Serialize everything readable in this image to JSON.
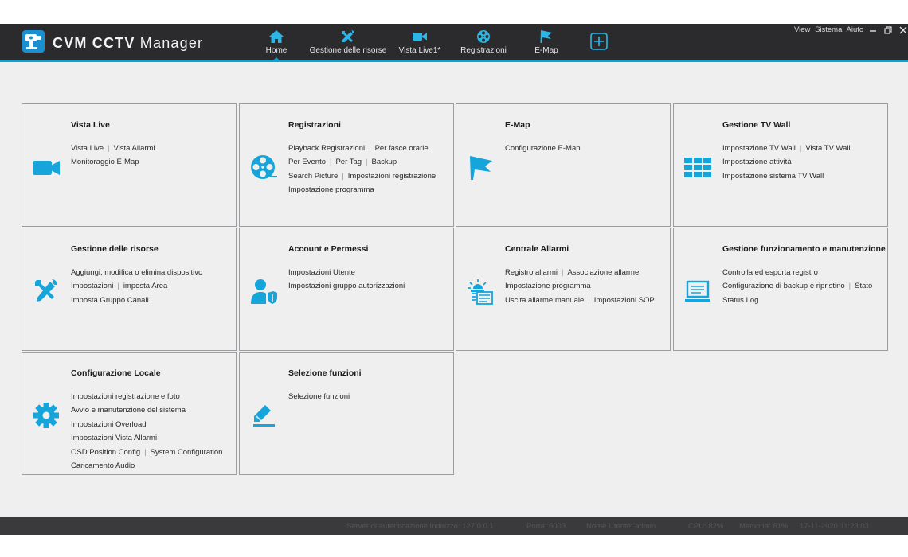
{
  "app": {
    "title_bold": "CVM CCTV",
    "title_rest": " Manager"
  },
  "nav": {
    "tabs": [
      {
        "label": "Home",
        "icon": "home-icon"
      },
      {
        "label": "Gestione delle risorse",
        "icon": "tools-icon"
      },
      {
        "label": "Vista Live1*",
        "icon": "camera-icon"
      },
      {
        "label": "Registrazioni",
        "icon": "film-reel-icon"
      },
      {
        "label": "E-Map",
        "icon": "flag-icon"
      }
    ],
    "active": "Home",
    "add_icon": "add-tab-icon"
  },
  "window_menu": {
    "view": "View",
    "system": "Sistema",
    "help": "Aiuto"
  },
  "colors": {
    "accent": "#0aa3d8",
    "titlebar": "#2b2b2d",
    "panel": "#efeff0",
    "border": "#9d9d9f",
    "statusbar": "#3a3a3c"
  },
  "cards": [
    {
      "title": "Vista Live",
      "icon": "camera-icon",
      "rows": [
        [
          "Vista Live",
          "Vista Allarmi"
        ],
        [
          "Monitoraggio E-Map"
        ]
      ]
    },
    {
      "title": "Registrazioni",
      "icon": "film-reel-icon",
      "rows": [
        [
          "Playback Registrazioni",
          "Per fasce orarie"
        ],
        [
          "Per Evento",
          "Per Tag",
          "Backup"
        ],
        [
          "Search Picture",
          "Impostazioni registrazione"
        ],
        [
          "Impostazione programma"
        ]
      ]
    },
    {
      "title": "E-Map",
      "icon": "flag-icon",
      "rows": [
        [
          "Configurazione E-Map"
        ]
      ]
    },
    {
      "title": "Gestione TV Wall",
      "icon": "tv-wall-icon",
      "rows": [
        [
          "Impostazione TV Wall",
          "Vista TV Wall"
        ],
        [
          "Impostazione attività"
        ],
        [
          "Impostazione sistema TV Wall"
        ]
      ]
    },
    {
      "title": "Gestione delle risorse",
      "icon": "tools-icon",
      "rows": [
        [
          "Aggiungi, modifica o elimina dispositivo"
        ],
        [
          "Impostazioni",
          "imposta Area"
        ],
        [
          "Imposta Gruppo Canali"
        ]
      ]
    },
    {
      "title": "Account e Permessi",
      "icon": "user-shield-icon",
      "rows": [
        [
          "Impostazioni Utente"
        ],
        [
          "Impostazioni gruppo autorizzazioni"
        ]
      ]
    },
    {
      "title": "Centrale Allarmi",
      "icon": "alarm-center-icon",
      "rows": [
        [
          "Registro allarmi",
          "Associazione allarme"
        ],
        [
          "Impostazione programma"
        ],
        [
          "Uscita allarme manuale",
          "Impostazioni SOP"
        ]
      ]
    },
    {
      "title": "Gestione funzionamento e manutenzione",
      "icon": "monitor-icon",
      "rows": [
        [
          "Controlla ed esporta registro"
        ],
        [
          "Configurazione di backup e ripristino",
          "Stato"
        ],
        [
          "Status Log"
        ]
      ]
    },
    {
      "title": "Configurazione Locale",
      "icon": "gear-icon",
      "rows": [
        [
          "Impostazioni registrazione e foto"
        ],
        [
          "Avvio e manutenzione del sistema"
        ],
        [
          "Impostazioni Overload"
        ],
        [
          "Impostazioni Vista Allarmi"
        ],
        [
          "OSD Position Config",
          "System Configuration"
        ],
        [
          "Caricamento Audio"
        ]
      ]
    },
    {
      "title": "Selezione funzioni",
      "icon": "edit-icon",
      "rows": [
        [
          "Selezione funzioni"
        ]
      ]
    }
  ],
  "status": {
    "server": "Server di autenticazione Indirizzo: 127.0.0.1",
    "port": "Porta: 6003",
    "user": "Nome Utente: admin",
    "cpu": "CPU: 82%",
    "memory": "Memoria: 61%",
    "datetime": "17-11-2020 11:23:03"
  }
}
